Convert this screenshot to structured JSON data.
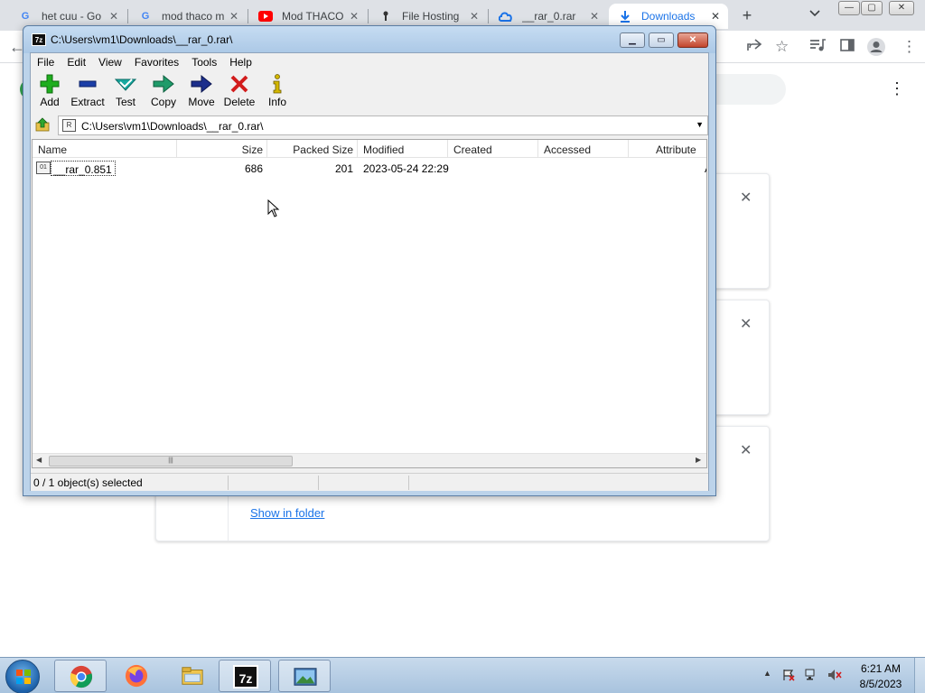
{
  "browser": {
    "tabs": [
      {
        "title": "het cuu - Go",
        "favicon": "google-icon",
        "active": false
      },
      {
        "title": "mod thaco m",
        "favicon": "google-icon",
        "active": false
      },
      {
        "title": "Mod THACO",
        "favicon": "youtube-icon",
        "active": false
      },
      {
        "title": "File Hosting",
        "favicon": "file-hosting-icon",
        "active": false
      },
      {
        "title": "__rar_0.rar",
        "favicon": "cloud-icon",
        "active": false
      },
      {
        "title": "Downloads",
        "favicon": "download-icon",
        "active": true
      }
    ],
    "new_tab_label": "+",
    "tab_close_glyph": "✕",
    "downloads_page": {
      "show_in_folder_label": "Show in folder",
      "card_close_glyph": "✕"
    }
  },
  "sevenzip": {
    "title": "C:\\Users\\vm1\\Downloads\\__rar_0.rar\\",
    "menu": [
      "File",
      "Edit",
      "View",
      "Favorites",
      "Tools",
      "Help"
    ],
    "toolbar": [
      {
        "label": "Add",
        "icon": "add-icon",
        "color": "#1fae1f"
      },
      {
        "label": "Extract",
        "icon": "extract-icon",
        "color": "#1c3fa8"
      },
      {
        "label": "Test",
        "icon": "test-icon",
        "color": "#17a9a0"
      },
      {
        "label": "Copy",
        "icon": "copy-icon",
        "color": "#1f9b6a"
      },
      {
        "label": "Move",
        "icon": "move-icon",
        "color": "#1c2f8c"
      },
      {
        "label": "Delete",
        "icon": "delete-icon",
        "color": "#d21c1c"
      },
      {
        "label": "Info",
        "icon": "info-icon",
        "color": "#b8a000"
      }
    ],
    "address": "C:\\Users\\vm1\\Downloads\\__rar_0.rar\\",
    "columns": [
      "Name",
      "Size",
      "Packed Size",
      "Modified",
      "Created",
      "Accessed",
      "Attribute"
    ],
    "rows": [
      {
        "name": "__rar_0.851",
        "size": "686",
        "packed_size": "201",
        "modified": "2023-05-24 22:29",
        "created": "",
        "accessed": "",
        "attributes": "A"
      }
    ],
    "status": "0 / 1 object(s) selected"
  },
  "taskbar": {
    "apps": [
      "chrome-icon",
      "firefox-icon",
      "file-explorer-icon",
      "7zip-icon",
      "image-viewer-icon"
    ],
    "seven_zip_label": "7z",
    "clock_time": "6:21 AM",
    "clock_date": "8/5/2023"
  }
}
